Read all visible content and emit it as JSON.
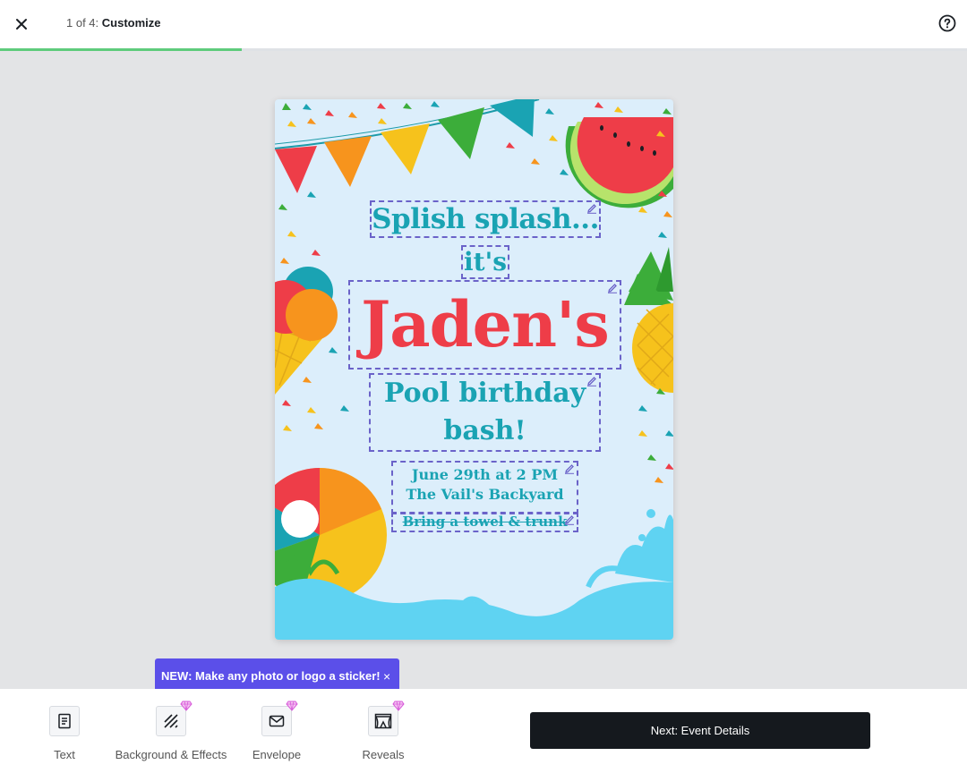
{
  "header": {
    "step_prefix": "1 of 4:",
    "step_title": "Customize",
    "progress_fraction": 0.25
  },
  "card": {
    "line1": "Splish splash...",
    "line2": "it's",
    "name": "Jaden's",
    "line4a": "Pool birthday",
    "line4b": "bash!",
    "date": "June 29th at 2 PM",
    "location": "The Vail's Backyard",
    "note": "Bring a towel & trunk"
  },
  "tooltip": {
    "text": "NEW: Make any photo or logo a sticker!",
    "close": "×"
  },
  "tools": [
    {
      "label": "Text",
      "icon": "text-document-icon",
      "premium": false
    },
    {
      "label": "Background & Effects",
      "icon": "hatch-pattern-icon",
      "premium": true
    },
    {
      "label": "Envelope",
      "icon": "envelope-icon",
      "premium": true
    },
    {
      "label": "Reveals",
      "icon": "stage-curtain-icon",
      "premium": true
    }
  ],
  "next_button": {
    "label": "Next: Event Details"
  },
  "colors": {
    "accent": "#5b4fe9",
    "progress": "#5ecb7c",
    "title_teal": "#1aa3b3",
    "name_red": "#ee3d48",
    "card_bg": "#dceefb",
    "water": "#5fd3f2",
    "premium_gem": "#d65ad9"
  }
}
